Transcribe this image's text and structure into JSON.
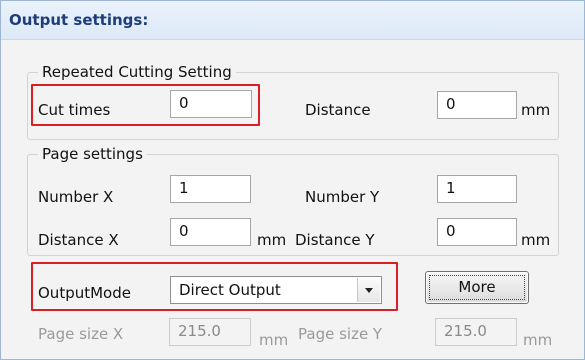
{
  "header": {
    "title": "Output settings:"
  },
  "repeated_cutting": {
    "legend": "Repeated Cutting Setting",
    "cut_times_label": "Cut times",
    "cut_times_value": "0",
    "distance_label": "Distance",
    "distance_value": "0",
    "distance_unit": "mm"
  },
  "page_settings": {
    "legend": "Page settings",
    "number_x_label": "Number X",
    "number_x_value": "1",
    "number_y_label": "Number Y",
    "number_y_value": "1",
    "distance_x_label": "Distance X",
    "distance_x_value": "0",
    "distance_x_unit": "mm",
    "distance_y_label": "Distance Y",
    "distance_y_value": "0",
    "distance_y_unit": "mm"
  },
  "output_mode": {
    "label": "OutputMode",
    "selected": "Direct Output",
    "more_button": "More"
  },
  "page_size": {
    "x_label": "Page size X",
    "x_value": "215.0",
    "x_unit": "mm",
    "y_label": "Page size Y",
    "y_value": "215.0",
    "y_unit": "mm"
  },
  "icons": {
    "dropdown": "chevron-down-icon"
  },
  "colors": {
    "highlight": "#d81f26",
    "header_text": "#1e3d7a"
  }
}
